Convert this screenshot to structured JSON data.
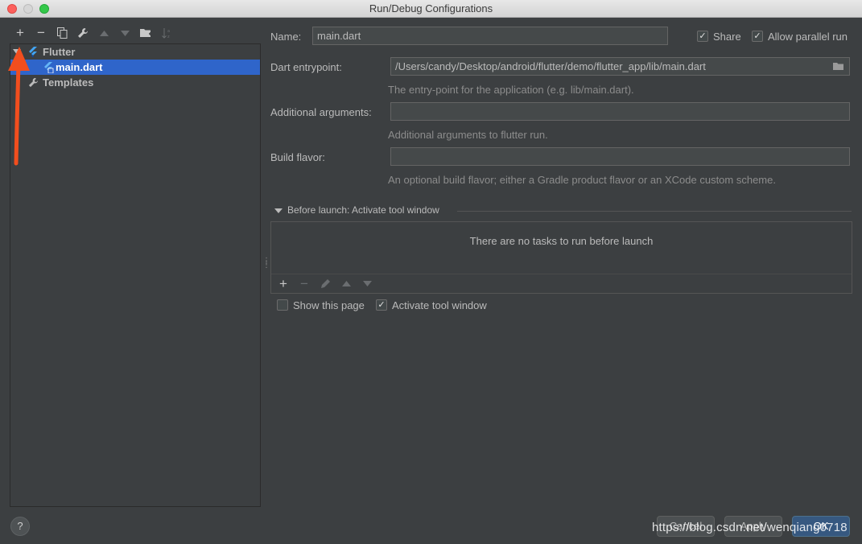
{
  "window": {
    "title": "Run/Debug Configurations"
  },
  "toolbar": {
    "add": "+",
    "remove": "−",
    "copy_icon": "copy-icon",
    "edit_icon": "wrench-icon",
    "up_icon": "arrow-up-icon",
    "down_icon": "arrow-down-icon",
    "folder_icon": "folder-add-icon",
    "sort_icon": "sort-icon"
  },
  "tree": {
    "items": [
      {
        "label": "Flutter",
        "icon": "flutter-icon",
        "expanded": true
      },
      {
        "label": "main.dart",
        "icon": "flutter-config-icon",
        "selected": true
      },
      {
        "label": "Templates",
        "icon": "wrench-icon"
      }
    ]
  },
  "form": {
    "name_label": "Name:",
    "name_value": "main.dart",
    "share_label": "Share",
    "share_checked": true,
    "parallel_label": "Allow parallel run",
    "parallel_checked": true,
    "entrypoint_label": "Dart entrypoint:",
    "entrypoint_value": "/Users/candy/Desktop/android/flutter/demo/flutter_app/lib/main.dart",
    "entrypoint_hint": "The entry-point for the application (e.g. lib/main.dart).",
    "args_label": "Additional arguments:",
    "args_value": "",
    "args_hint": "Additional arguments to flutter run.",
    "flavor_label": "Build flavor:",
    "flavor_value": "",
    "flavor_hint": "An optional build flavor; either a Gradle product flavor or an XCode custom scheme."
  },
  "before_launch": {
    "title": "Before launch: Activate tool window",
    "empty_text": "There are no tasks to run before launch",
    "add": "+",
    "remove": "−"
  },
  "options": {
    "show_page_label": "Show this page",
    "show_page_checked": false,
    "activate_label": "Activate tool window",
    "activate_checked": true
  },
  "footer": {
    "help": "?",
    "cancel": "Cancel",
    "apply": "Apply",
    "ok": "OK"
  },
  "watermark": "https://blog.csdn.net/wenqiang0718",
  "colors": {
    "annotation_arrow": "#f24e1e",
    "selection": "#2f65ca",
    "flutter_blue": "#42a5f5"
  }
}
